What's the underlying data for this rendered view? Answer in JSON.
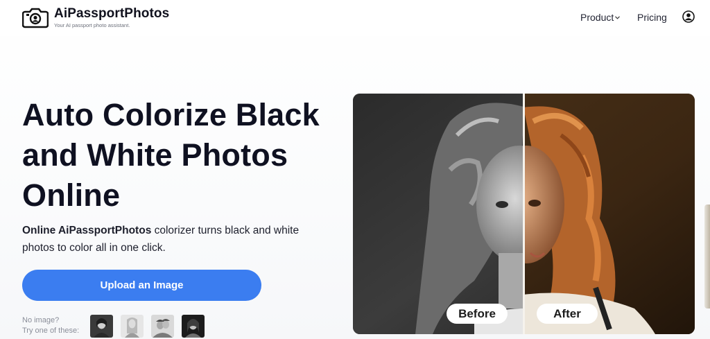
{
  "brand": {
    "name": "AiPassportPhotos",
    "tagline": "Your AI passport photo assistant."
  },
  "nav": {
    "product_label": "Product",
    "pricing_label": "Pricing"
  },
  "hero": {
    "title": "Auto Colorize Black and White Photos Online",
    "subtitle_bold": "Online AiPassportPhotos",
    "subtitle_rest": " colorizer turns black and white photos to color all in one click.",
    "upload_label": "Upload an Image",
    "no_image_line1": "No image?",
    "no_image_line2": "Try one of these:"
  },
  "compare": {
    "before_label": "Before",
    "after_label": "After"
  },
  "colors": {
    "accent": "#3b7df0",
    "text_dark": "#0f1121",
    "muted": "#8a8e99"
  }
}
